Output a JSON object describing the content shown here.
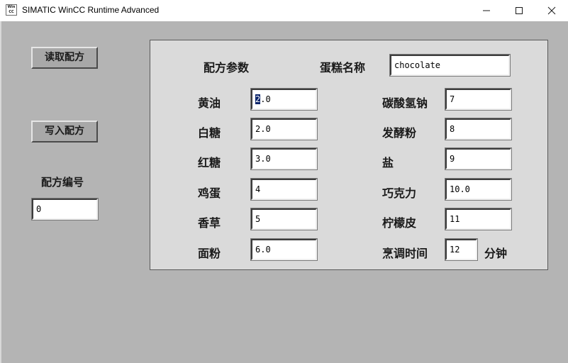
{
  "window": {
    "title": "SIMATIC WinCC Runtime Advanced",
    "icon_text": [
      "Win",
      "CC",
      "RT"
    ],
    "controls": [
      "minimize-icon",
      "maximize-icon",
      "close-icon"
    ]
  },
  "buttons": {
    "read_recipe": "读取配方",
    "write_recipe": "写入配方"
  },
  "recipe_number": {
    "label": "配方编号",
    "value": "0"
  },
  "panel": {
    "params_header": "配方参数",
    "cake_name_label": "蛋糕名称",
    "cake_name_value": "chocolate",
    "left_params": [
      {
        "label": "黄油",
        "value": "2.0"
      },
      {
        "label": "白糖",
        "value": "2.0"
      },
      {
        "label": "红糖",
        "value": "3.0"
      },
      {
        "label": "鸡蛋",
        "value": "4"
      },
      {
        "label": "香草",
        "value": "5"
      },
      {
        "label": "面粉",
        "value": "6.0"
      }
    ],
    "right_params": [
      {
        "label": "碳酸氢钠",
        "value": "7"
      },
      {
        "label": "发酵粉",
        "value": "8"
      },
      {
        "label": "盐",
        "value": "9"
      },
      {
        "label": "巧克力",
        "value": "10.0"
      },
      {
        "label": "柠檬皮",
        "value": "11"
      },
      {
        "label": "烹调时间",
        "value": "12"
      }
    ],
    "time_unit": "分钟",
    "butter_selected_char": "2",
    "butter_rest": ".0"
  },
  "colors": {
    "background": "#b4b4b4",
    "panel": "#dadada",
    "selection": "#0a246a"
  }
}
